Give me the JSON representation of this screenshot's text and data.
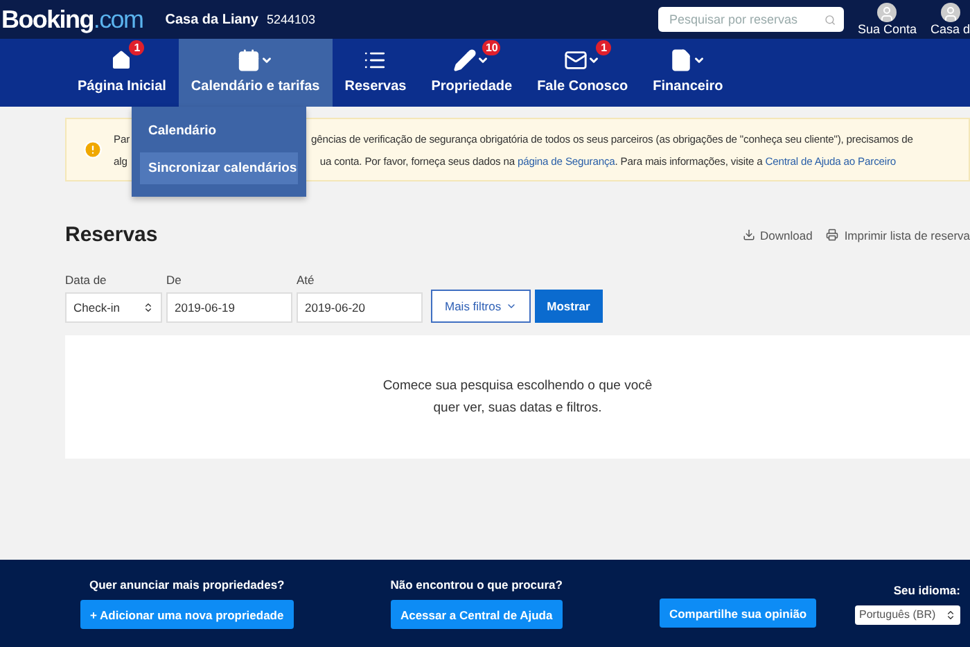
{
  "header": {
    "logo": {
      "part1": "Booking",
      "part2": ".com"
    },
    "property_name": "Casa da Liany",
    "property_id": "5244103",
    "search": {
      "placeholder": "Pesquisar por reservas"
    },
    "account": [
      {
        "label": "Sua Conta"
      },
      {
        "label": "Casa d"
      }
    ]
  },
  "nav": [
    {
      "label": "Página Inicial",
      "badge": "1",
      "dropdown": false,
      "selected": false
    },
    {
      "label": "Calendário e tarifas",
      "dropdown": true,
      "selected": true
    },
    {
      "label": "Reservas",
      "dropdown": false,
      "selected": false
    },
    {
      "label": "Propriedade",
      "badge": "10",
      "dropdown": true,
      "selected": false
    },
    {
      "label": "Fale Conosco",
      "badge": "1",
      "dropdown": true,
      "selected": false
    },
    {
      "label": "Financeiro",
      "dropdown": true,
      "selected": false
    }
  ],
  "dropdown_menu": [
    {
      "label": "Calendário",
      "selected": false
    },
    {
      "label": "Sincronizar calendários",
      "selected": true
    }
  ],
  "alert": {
    "line1_start": "Par",
    "line1_rest": "gências de verificação de segurança obrigatória de todos os seus parceiros (as obrigações de \"conheça seu cliente\"), precisamos de",
    "line2_start": "alg",
    "line2_rest": "ua conta. Por favor, forneça seus dados na",
    "link1": "página de Segurança",
    "middle": ". Para mais informações, visite a",
    "link2": "Central de Ajuda ao Parceiro"
  },
  "page": {
    "title": "Reservas",
    "actions": [
      {
        "label": "Download"
      },
      {
        "label": "Imprimir lista de reserva"
      }
    ]
  },
  "filters": {
    "date_type": {
      "label": "Data de",
      "value": "Check-in"
    },
    "from": {
      "label": "De",
      "value": "2019-06-19"
    },
    "to": {
      "label": "Até",
      "value": "2019-06-20"
    },
    "more_button": "Mais filtros",
    "show_button": "Mostrar"
  },
  "empty_message": "Comece sua pesquisa escolhendo o que você quer ver, suas datas e filtros.",
  "footer": {
    "columns": [
      {
        "heading": "Quer anunciar mais propriedades?",
        "button": "+ Adicionar uma nova propriedade"
      },
      {
        "heading": "Não encontrou o que procura?",
        "button": "Acessar a Central de Ajuda"
      },
      {
        "button": "Compartilhe sua opinião"
      }
    ],
    "language": {
      "label": "Seu idioma:",
      "value": "Português (BR)"
    }
  }
}
